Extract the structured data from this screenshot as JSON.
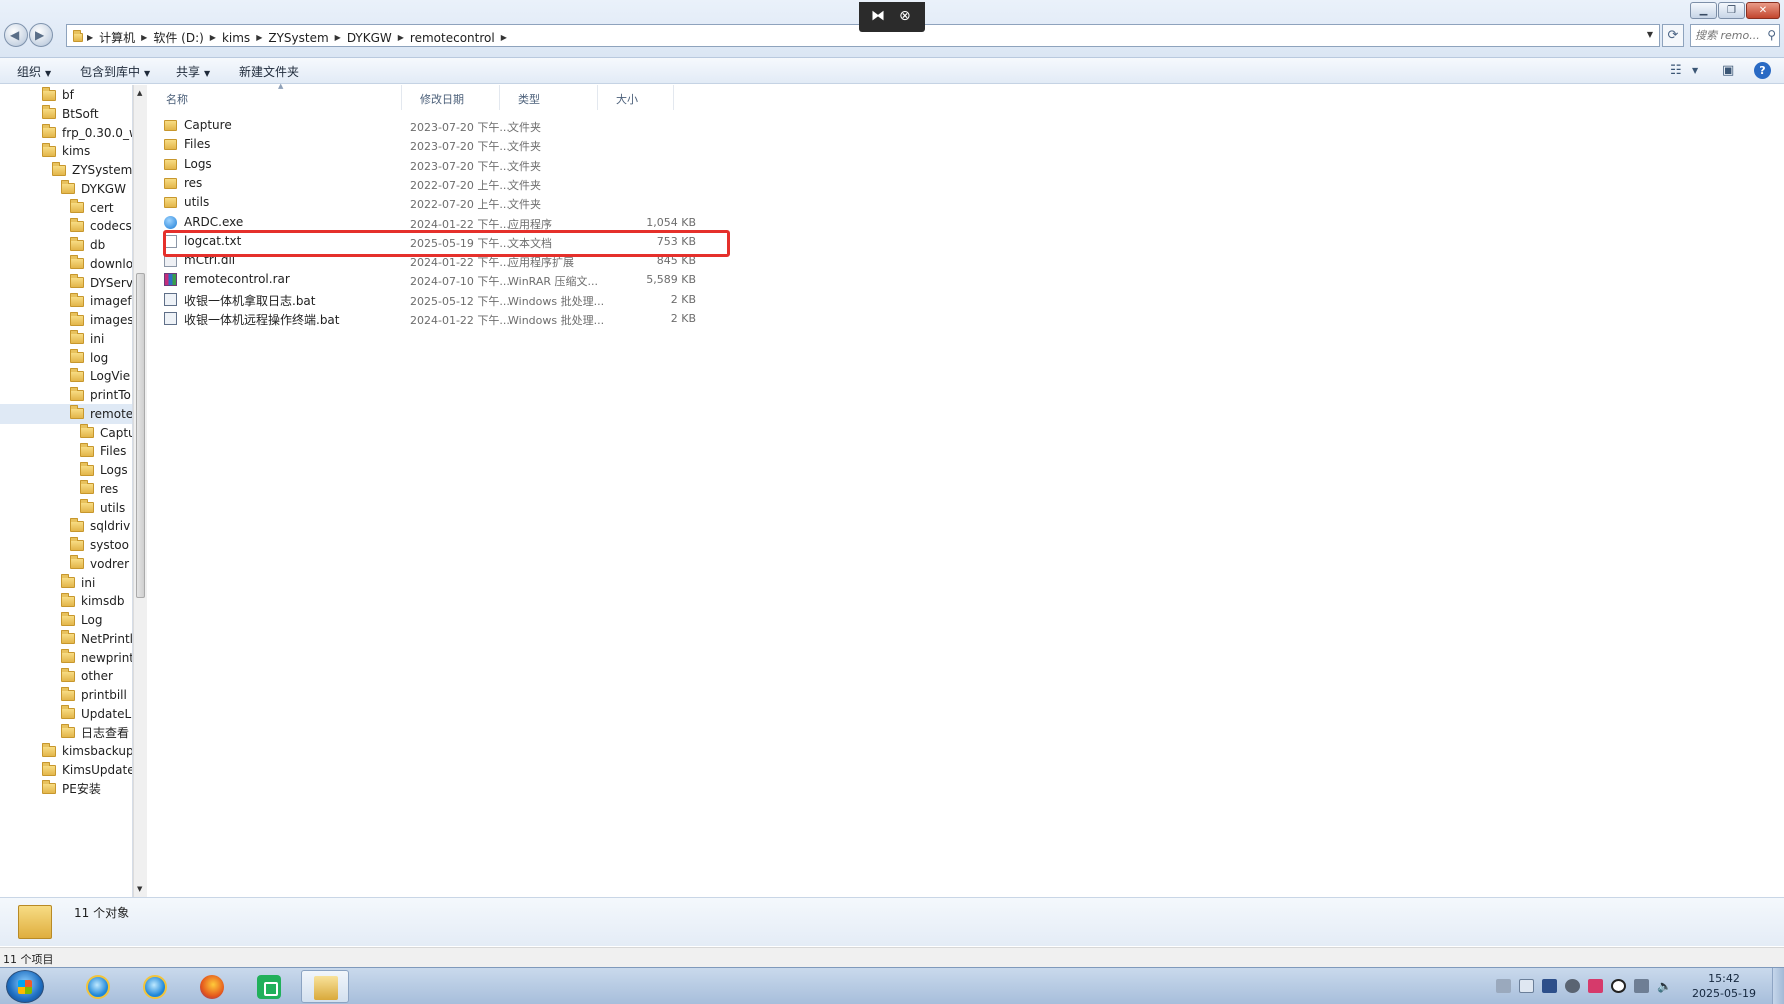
{
  "address_bar": {
    "crumbs": [
      "计算机",
      "软件 (D:)",
      "kims",
      "ZYSystem",
      "DYKGW",
      "remotecontrol"
    ],
    "search_placeholder": "搜索 remo..."
  },
  "toolbar": {
    "organize": "组织",
    "include_in_library": "包含到库中",
    "share": "共享",
    "new_folder": "新建文件夹"
  },
  "nav_tree": [
    {
      "label": "bf",
      "level": 0
    },
    {
      "label": "BtSoft",
      "level": 0
    },
    {
      "label": "frp_0.30.0_w",
      "level": 0
    },
    {
      "label": "kims",
      "level": 0
    },
    {
      "label": "ZYSystem",
      "level": 1
    },
    {
      "label": "DYKGW",
      "level": 2
    },
    {
      "label": "cert",
      "level": 3
    },
    {
      "label": "codecs",
      "level": 3
    },
    {
      "label": "db",
      "level": 3
    },
    {
      "label": "downlo",
      "level": 3
    },
    {
      "label": "DYServ",
      "level": 3
    },
    {
      "label": "imagef",
      "level": 3
    },
    {
      "label": "images",
      "level": 3
    },
    {
      "label": "ini",
      "level": 3
    },
    {
      "label": "log",
      "level": 3
    },
    {
      "label": "LogVie",
      "level": 3
    },
    {
      "label": "printTo",
      "level": 3
    },
    {
      "label": "remote",
      "level": 3,
      "selected": true
    },
    {
      "label": "Captu",
      "level": 4
    },
    {
      "label": "Files",
      "level": 4
    },
    {
      "label": "Logs",
      "level": 4
    },
    {
      "label": "res",
      "level": 4
    },
    {
      "label": "utils",
      "level": 4
    },
    {
      "label": "sqldriv",
      "level": 3
    },
    {
      "label": "systoo",
      "level": 3
    },
    {
      "label": "vodrer",
      "level": 3
    },
    {
      "label": "ini",
      "level": 2
    },
    {
      "label": "kimsdb",
      "level": 2
    },
    {
      "label": "Log",
      "level": 2
    },
    {
      "label": "NetPrintl",
      "level": 2
    },
    {
      "label": "newprint",
      "level": 2
    },
    {
      "label": "other",
      "level": 2
    },
    {
      "label": "printbill",
      "level": 2
    },
    {
      "label": "UpdateL",
      "level": 2
    },
    {
      "label": "日志查看",
      "level": 2
    },
    {
      "label": "kimsbackup",
      "level": 0
    },
    {
      "label": "KimsUpdate",
      "level": 0
    },
    {
      "label": "PE安装",
      "level": 0
    }
  ],
  "columns": {
    "name": "名称",
    "modified": "修改日期",
    "type": "类型",
    "size": "大小"
  },
  "files": [
    {
      "name": "Capture",
      "modified": "2023-07-20 下午...",
      "type": "文件夹",
      "size": "",
      "icon": "folder-icon"
    },
    {
      "name": "Files",
      "modified": "2023-07-20 下午...",
      "type": "文件夹",
      "size": "",
      "icon": "folder-icon"
    },
    {
      "name": "Logs",
      "modified": "2023-07-20 下午...",
      "type": "文件夹",
      "size": "",
      "icon": "folder-icon"
    },
    {
      "name": "res",
      "modified": "2022-07-20 上午...",
      "type": "文件夹",
      "size": "",
      "icon": "folder-icon"
    },
    {
      "name": "utils",
      "modified": "2022-07-20 上午...",
      "type": "文件夹",
      "size": "",
      "icon": "folder-icon"
    },
    {
      "name": "ARDC.exe",
      "modified": "2024-01-22 下午...",
      "type": "应用程序",
      "size": "1,054 KB",
      "icon": "exe-icon"
    },
    {
      "name": "logcat.txt",
      "modified": "2025-05-19 下午...",
      "type": "文本文档",
      "size": "753 KB",
      "icon": "txt-icon",
      "highlighted": true
    },
    {
      "name": "mCtrl.dll",
      "modified": "2024-01-22 下午...",
      "type": "应用程序扩展",
      "size": "845 KB",
      "icon": "dll-icon"
    },
    {
      "name": "remotecontrol.rar",
      "modified": "2024-07-10 下午...",
      "type": "WinRAR 压缩文...",
      "size": "5,589 KB",
      "icon": "rar-icon"
    },
    {
      "name": "收银一体机拿取日志.bat",
      "modified": "2025-05-12 下午...",
      "type": "Windows 批处理...",
      "size": "2 KB",
      "icon": "bat-icon"
    },
    {
      "name": "收银一体机远程操作终端.bat",
      "modified": "2024-01-22 下午...",
      "type": "Windows 批处理...",
      "size": "2 KB",
      "icon": "bat-icon"
    }
  ],
  "details_pane": {
    "summary": "11 个对象"
  },
  "status_bar": {
    "text": "11 个项目"
  },
  "taskbar": {
    "clock_time": "15:42",
    "clock_date": "2025-05-19",
    "apps": [
      "ie-icon",
      "ie-icon",
      "firefox-icon",
      "green-app-icon",
      "explorer-icon"
    ]
  },
  "colors": {
    "highlight_box": "#e5302b",
    "selected_row": "#dfe9f5"
  }
}
